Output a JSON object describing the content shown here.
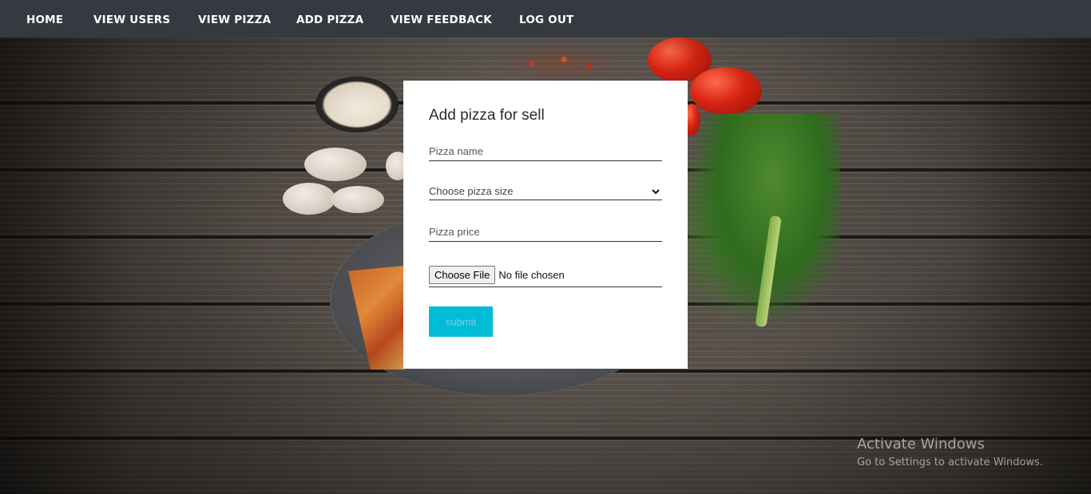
{
  "nav": {
    "items": [
      {
        "label": "HOME"
      },
      {
        "label": "VIEW USERS"
      },
      {
        "label": "VIEW PIZZA"
      },
      {
        "label": "ADD PIZZA"
      },
      {
        "label": "VIEW FEEDBACK"
      },
      {
        "label": "LOG OUT"
      }
    ]
  },
  "form": {
    "title": "Add pizza for sell",
    "pizza_name": {
      "placeholder": "Pizza name",
      "value": ""
    },
    "pizza_size": {
      "selected": "Choose pizza size"
    },
    "pizza_price": {
      "placeholder": "Pizza price",
      "value": ""
    },
    "file": {
      "button_label": "Choose File",
      "status": "No file chosen"
    },
    "submit_label": "submit"
  },
  "watermark": {
    "title": "Activate Windows",
    "subtitle": "Go to Settings to activate Windows."
  },
  "colors": {
    "navbar": "#343a40",
    "submit": "#00bcd4",
    "card": "#ffffff"
  }
}
